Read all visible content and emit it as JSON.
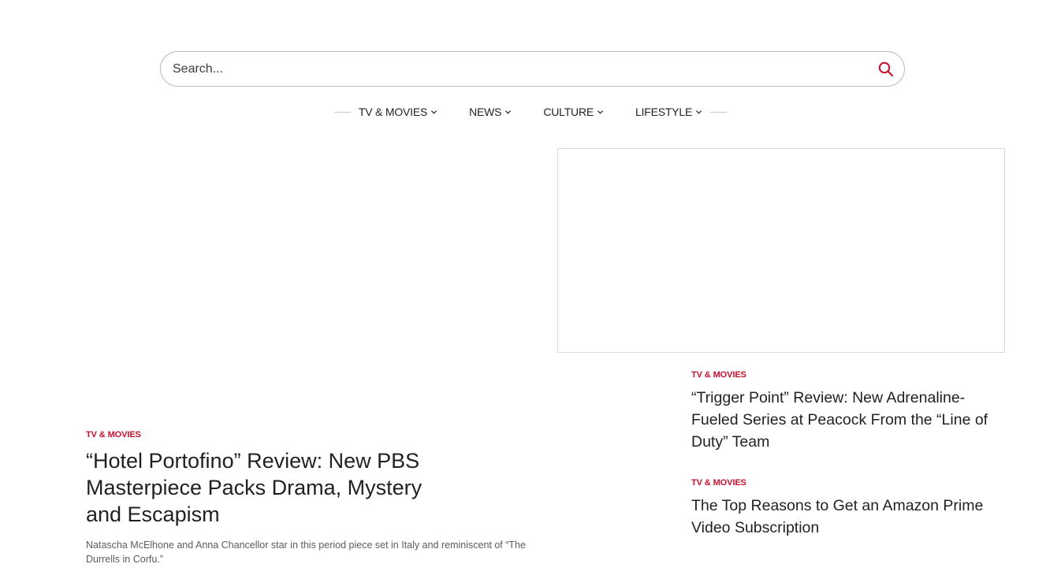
{
  "search": {
    "placeholder": "Search..."
  },
  "nav": {
    "items": [
      {
        "label": "TV & MOVIES"
      },
      {
        "label": "NEWS"
      },
      {
        "label": "CULTURE"
      },
      {
        "label": "LIFESTYLE"
      }
    ]
  },
  "colors": {
    "accent": "#c8102e",
    "text": "#1f2023",
    "muted": "#5c5c5c"
  },
  "feature": {
    "category": "TV & MOVIES",
    "title": "“Hotel Portofino” Review: New PBS Masterpiece Packs Drama, Mystery and Escapism",
    "excerpt": "Natascha McElhone and Anna Chancellor star in this period piece set in Italy and reminiscent of “The Durrells in Corfu.”"
  },
  "side_articles": [
    {
      "category": "TV & MOVIES",
      "title": "“Trigger Point” Review: New Adrenaline-Fueled Series at Peacock From the “Line of Duty” Team"
    },
    {
      "category": "TV & MOVIES",
      "title": "The Top Reasons to Get an Amazon Prime Video Subscription"
    }
  ]
}
